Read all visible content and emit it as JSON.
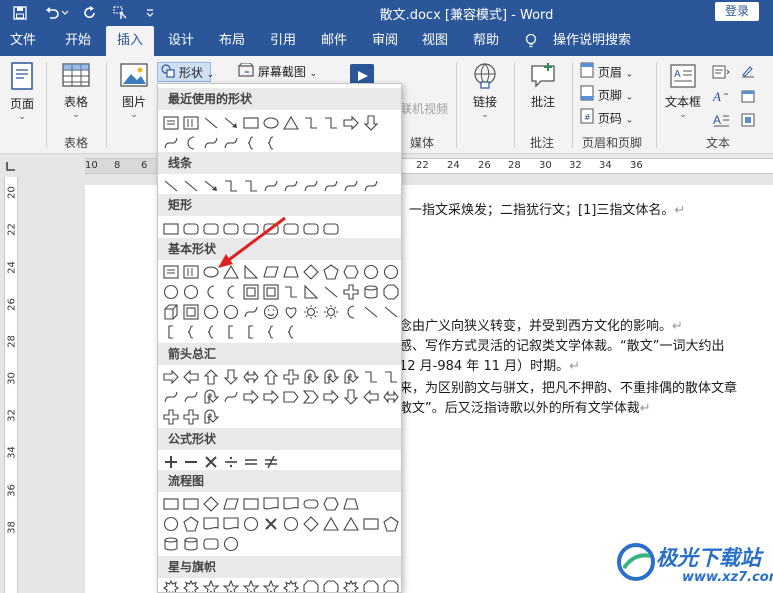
{
  "window": {
    "title": "散文.docx [兼容模式] - Word",
    "login_label": "登录"
  },
  "tabs": [
    {
      "label": "文件"
    },
    {
      "label": "开始"
    },
    {
      "label": "插入"
    },
    {
      "label": "设计"
    },
    {
      "label": "布局"
    },
    {
      "label": "引用"
    },
    {
      "label": "邮件"
    },
    {
      "label": "审阅"
    },
    {
      "label": "视图"
    },
    {
      "label": "帮助"
    }
  ],
  "active_tab": "插入",
  "tell_me": "操作说明搜索",
  "ribbon": {
    "page_label": "页面",
    "table_label": "表格",
    "table_group": "表格",
    "picture_label": "图片",
    "shapes_label": "形状",
    "screenshot_label": "屏幕截图",
    "online_video_label": "联机视频",
    "media_group": "媒体",
    "link_label": "链接",
    "comment_label": "批注",
    "comment_group": "批注",
    "header_label": "页眉",
    "footer_label": "页脚",
    "page_number_label": "页码",
    "header_footer_group": "页眉和页脚",
    "textbox_label": "文本框",
    "text_group": "文本"
  },
  "ruler": {
    "h_numbers": [
      "10",
      "8",
      "6",
      "22",
      "24",
      "26",
      "28",
      "30",
      "32",
      "34",
      "36"
    ],
    "v_numbers": [
      "20",
      "22",
      "24",
      "26",
      "28",
      "30",
      "32",
      "34",
      "36",
      "38"
    ]
  },
  "document": {
    "lines": [
      "一指文采焕发；二指犹行文；[1]三指文体名。",
      "念由广义向狭义转变，并受到西方文化的影响。",
      "感、写作方式灵活的记叙类文学体裁。“散文”一词大约出",
      "12 月-984 年 11 月）时期。",
      "来，为区别韵文与骈文，把凡不押韵、不重排偶的散体文章",
      "散文”。后又泛指诗歌以外的所有文学体裁"
    ]
  },
  "gallery": {
    "sections": [
      {
        "title": "最近使用的形状"
      },
      {
        "title": "线条"
      },
      {
        "title": "矩形"
      },
      {
        "title": "基本形状"
      },
      {
        "title": "箭头总汇"
      },
      {
        "title": "公式形状"
      },
      {
        "title": "流程图"
      },
      {
        "title": "星与旗帜"
      }
    ]
  },
  "watermark": {
    "name": "极光下载站",
    "url": "www.xz7.com"
  },
  "colors": {
    "accent": "#2b579a",
    "ribbon_bg": "#f3f3f3",
    "arrow": "#e02020",
    "watermark": "#2a6fc9"
  }
}
